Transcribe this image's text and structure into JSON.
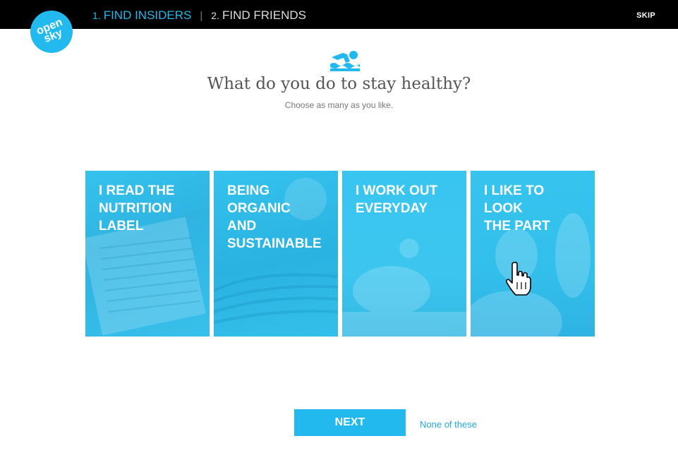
{
  "header": {
    "steps": [
      {
        "num": "1.",
        "label": "FIND INSIDERS",
        "active": true
      },
      {
        "num": "2.",
        "label": "FIND FRIENDS",
        "active": false
      }
    ],
    "divider": "|",
    "skip_label": "SKIP"
  },
  "logo": {
    "text": "open sky"
  },
  "icon": "swimmer-icon",
  "question": "What do you do to stay healthy?",
  "subtitle": "Choose as many as you like.",
  "cards": [
    {
      "label": "I READ THE\nNUTRITION\nLABEL"
    },
    {
      "label": "BEING\nORGANIC\nAND\nSUSTAINABLE"
    },
    {
      "label": "I WORK OUT\nEVERYDAY"
    },
    {
      "label": "I LIKE TO\nLOOK\nTHE PART"
    }
  ],
  "footer": {
    "next_label": "NEXT",
    "none_label": "None of these"
  },
  "colors": {
    "accent": "#21b9ee",
    "topbar": "#000000",
    "card": "#33c4ef"
  }
}
